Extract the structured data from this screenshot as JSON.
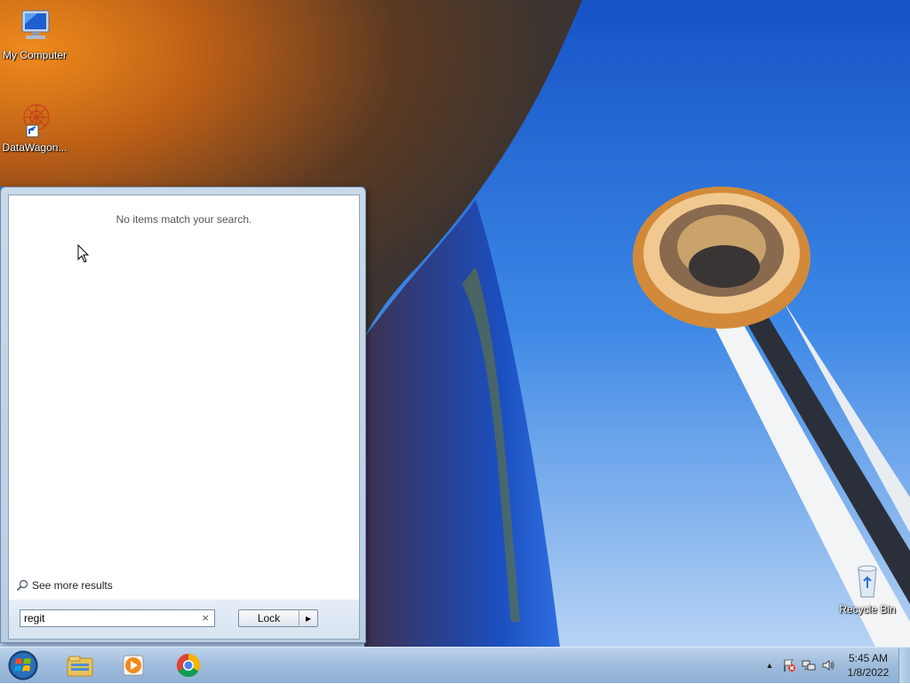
{
  "desktop": {
    "icons": [
      {
        "label": "My Computer",
        "icon": "computer-icon"
      },
      {
        "label": "DataWagon...",
        "icon": "datawagon-shortcut-icon"
      },
      {
        "label": "Recycle Bin",
        "icon": "recycle-bin-icon"
      }
    ]
  },
  "start_menu": {
    "no_results_text": "No items match your search.",
    "see_more_label": "See more results",
    "search": {
      "value": "regit",
      "clear_glyph": "×"
    },
    "lock_label": "Lock",
    "lock_arrow_glyph": "▸"
  },
  "taskbar": {
    "pinned": [
      {
        "name": "windows-explorer",
        "icon": "folder-icon"
      },
      {
        "name": "windows-media-player",
        "icon": "media-player-icon"
      },
      {
        "name": "google-chrome",
        "icon": "chrome-icon"
      }
    ],
    "tray": {
      "expand_glyph": "▲",
      "icons": [
        "action-center-flag-icon",
        "network-icon",
        "volume-icon"
      ],
      "time": "5:45 AM",
      "date": "1/8/2022"
    }
  },
  "colors": {
    "taskbar": "#9fbcdc",
    "sky": "#2f7ae0",
    "start_menu_frame": "#c9d9ea"
  }
}
